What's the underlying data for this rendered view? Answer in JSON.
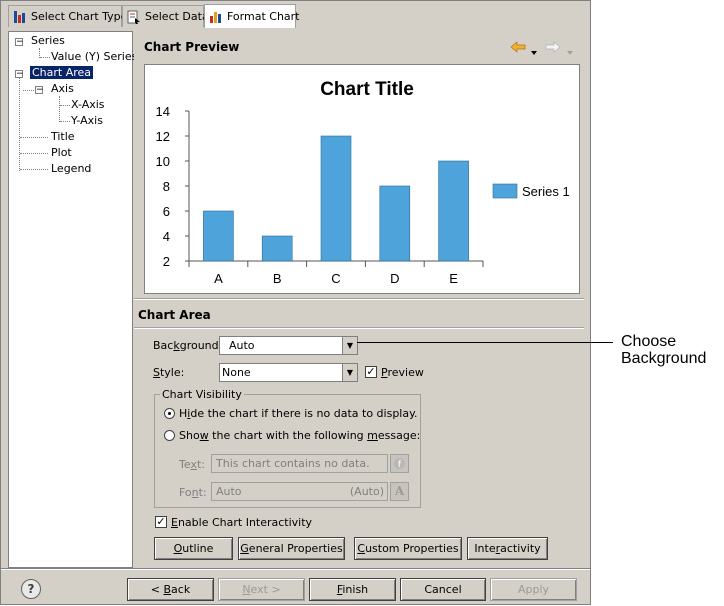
{
  "tabs": [
    {
      "label": "Select Chart Type",
      "icon": "chart-type-icon",
      "active": false
    },
    {
      "label": "Select Data",
      "icon": "select-data-icon",
      "active": false
    },
    {
      "label": "Format Chart",
      "icon": "format-chart-icon",
      "active": true
    }
  ],
  "tree": {
    "series": "Series",
    "value_series": "Value (Y) Series",
    "chart_area": "Chart Area",
    "axis": "Axis",
    "x_axis": "X-Axis",
    "y_axis": "Y-Axis",
    "title": "Title",
    "plot": "Plot",
    "legend": "Legend"
  },
  "preview": {
    "heading": "Chart Preview"
  },
  "chart_data": {
    "type": "bar",
    "title": "Chart Title",
    "categories": [
      "A",
      "B",
      "C",
      "D",
      "E"
    ],
    "series": [
      {
        "name": "Series 1",
        "values": [
          6,
          4,
          12,
          8,
          10
        ],
        "color": "#4fa3db"
      }
    ],
    "ylim": [
      2,
      14
    ],
    "yticks": [
      2,
      4,
      6,
      8,
      10,
      12,
      14
    ],
    "xlabel": "",
    "ylabel": "",
    "legend_position": "right",
    "grid": false
  },
  "chart_area": {
    "heading": "Chart Area",
    "background_label": "Background:",
    "background_value": "Auto",
    "style_label": "Style:",
    "style_value": "None",
    "preview_label": "Preview",
    "preview_checked": true,
    "visibility": {
      "legend": "Chart Visibility",
      "hide_option": "Hide the chart if there is no data to display.",
      "show_option": "Show the chart with the following message:",
      "text_label": "Text:",
      "text_value": "This chart contains no data.",
      "font_label": "Font:",
      "font_value": "Auto",
      "font_suffix": "(Auto)",
      "font_button": "A"
    },
    "interactivity_label": "Enable Chart Interactivity",
    "interactivity_checked": true,
    "buttons": {
      "outline": "Outline",
      "general": "General Properties",
      "custom": "Custom Properties",
      "interactivity": "Interactivity"
    }
  },
  "footer": {
    "help": "?",
    "back": "< Back",
    "next": "Next >",
    "finish": "Finish",
    "cancel": "Cancel",
    "apply": "Apply"
  },
  "callout": {
    "line1": "Choose",
    "line2": "Background"
  },
  "colors": {
    "dialog_bg": "#d4d0c8",
    "selection": "#0a246a",
    "bar": "#4fa3db",
    "nav_back_arrow": "#f0b030"
  }
}
